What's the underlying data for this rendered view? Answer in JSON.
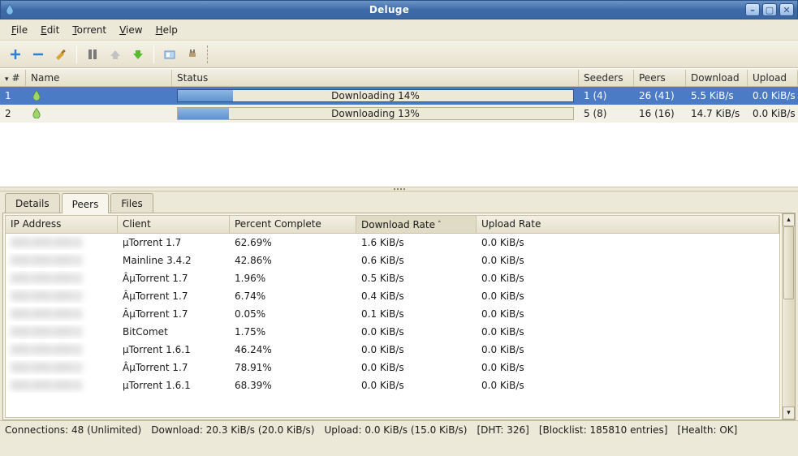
{
  "window": {
    "title": "Deluge"
  },
  "menu": {
    "file": "File",
    "edit": "Edit",
    "torrent": "Torrent",
    "view": "View",
    "help": "Help"
  },
  "columns": {
    "num": "#",
    "name": "Name",
    "status": "Status",
    "seeders": "Seeders",
    "peers": "Peers",
    "download": "Download",
    "upload": "Upload"
  },
  "torrents": [
    {
      "num": "1",
      "progress": 14,
      "status_label": "Downloading 14%",
      "seeders": "1 (4)",
      "peers": "26 (41)",
      "download": "5.5 KiB/s",
      "upload": "0.0 KiB/s",
      "selected": true
    },
    {
      "num": "2",
      "progress": 13,
      "status_label": "Downloading 13%",
      "seeders": "5 (8)",
      "peers": "16 (16)",
      "download": "14.7 KiB/s",
      "upload": "0.0 KiB/s",
      "selected": false
    }
  ],
  "tabs": {
    "details": "Details",
    "peers": "Peers",
    "files": "Files",
    "active": "peers"
  },
  "peer_columns": {
    "ip": "IP Address",
    "client": "Client",
    "pct": "Percent Complete",
    "dl": "Download Rate",
    "ul": "Upload Rate"
  },
  "peers": [
    {
      "ip": "",
      "client": "µTorrent 1.7",
      "pct": "62.69%",
      "dl": "1.6 KiB/s",
      "ul": "0.0 KiB/s"
    },
    {
      "ip": "",
      "client": "Mainline 3.4.2",
      "pct": "42.86%",
      "dl": "0.6 KiB/s",
      "ul": "0.0 KiB/s"
    },
    {
      "ip": "",
      "client": "ÂµTorrent 1.7",
      "pct": "1.96%",
      "dl": "0.5 KiB/s",
      "ul": "0.0 KiB/s"
    },
    {
      "ip": "",
      "client": "ÂµTorrent 1.7",
      "pct": "6.74%",
      "dl": "0.4 KiB/s",
      "ul": "0.0 KiB/s"
    },
    {
      "ip": "",
      "client": "ÂµTorrent 1.7",
      "pct": "0.05%",
      "dl": "0.1 KiB/s",
      "ul": "0.0 KiB/s"
    },
    {
      "ip": "",
      "client": "BitComet",
      "pct": "1.75%",
      "dl": "0.0 KiB/s",
      "ul": "0.0 KiB/s"
    },
    {
      "ip": "",
      "client": "µTorrent 1.6.1",
      "pct": "46.24%",
      "dl": "0.0 KiB/s",
      "ul": "0.0 KiB/s"
    },
    {
      "ip": "",
      "client": "ÂµTorrent 1.7",
      "pct": "78.91%",
      "dl": "0.0 KiB/s",
      "ul": "0.0 KiB/s"
    },
    {
      "ip": "",
      "client": "µTorrent 1.6.1",
      "pct": "68.39%",
      "dl": "0.0 KiB/s",
      "ul": "0.0 KiB/s"
    }
  ],
  "status": {
    "connections": "Connections: 48 (Unlimited)",
    "download": "Download: 20.3 KiB/s (20.0 KiB/s)",
    "upload": "Upload: 0.0 KiB/s (15.0 KiB/s)",
    "dht": "[DHT: 326]",
    "blocklist": "[Blocklist: 185810 entries]",
    "health": "[Health: OK]"
  }
}
